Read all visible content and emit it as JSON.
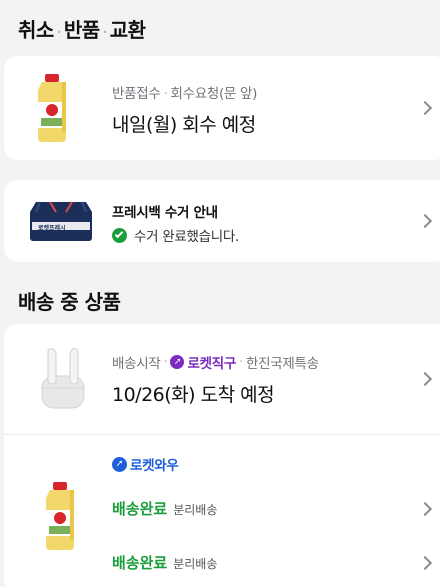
{
  "sections": {
    "cancel": {
      "part1": "취소",
      "part2": "반품",
      "part3": "교환",
      "dot": "·"
    },
    "shipping": {
      "title": "배송 중 상품"
    }
  },
  "return_card": {
    "status": "반품접수",
    "detail": "회수요청(문 앞)",
    "sep": "·",
    "main": "내일(월) 회수 예정"
  },
  "freshbag_card": {
    "title": "프레시백 수거 안내",
    "status": "수거 완료했습니다.",
    "bag_label": "로켓프레시"
  },
  "shipping_card": {
    "start": "배송시작",
    "badge": "로켓직구",
    "carrier": "한진국제특송",
    "sep": "·",
    "eta": "10/26(화) 도착 예정"
  },
  "wow_card": {
    "badge": "로켓와우",
    "rows": [
      {
        "status": "배송완료",
        "note": "분리배송"
      },
      {
        "status": "배송완료",
        "note": "분리배송"
      }
    ]
  },
  "colors": {
    "green": "#1a9e3a",
    "rocket_purple": "#7b2cbf",
    "rocket_blue": "#1e5fd9",
    "bag_navy": "#1c2e5a"
  }
}
